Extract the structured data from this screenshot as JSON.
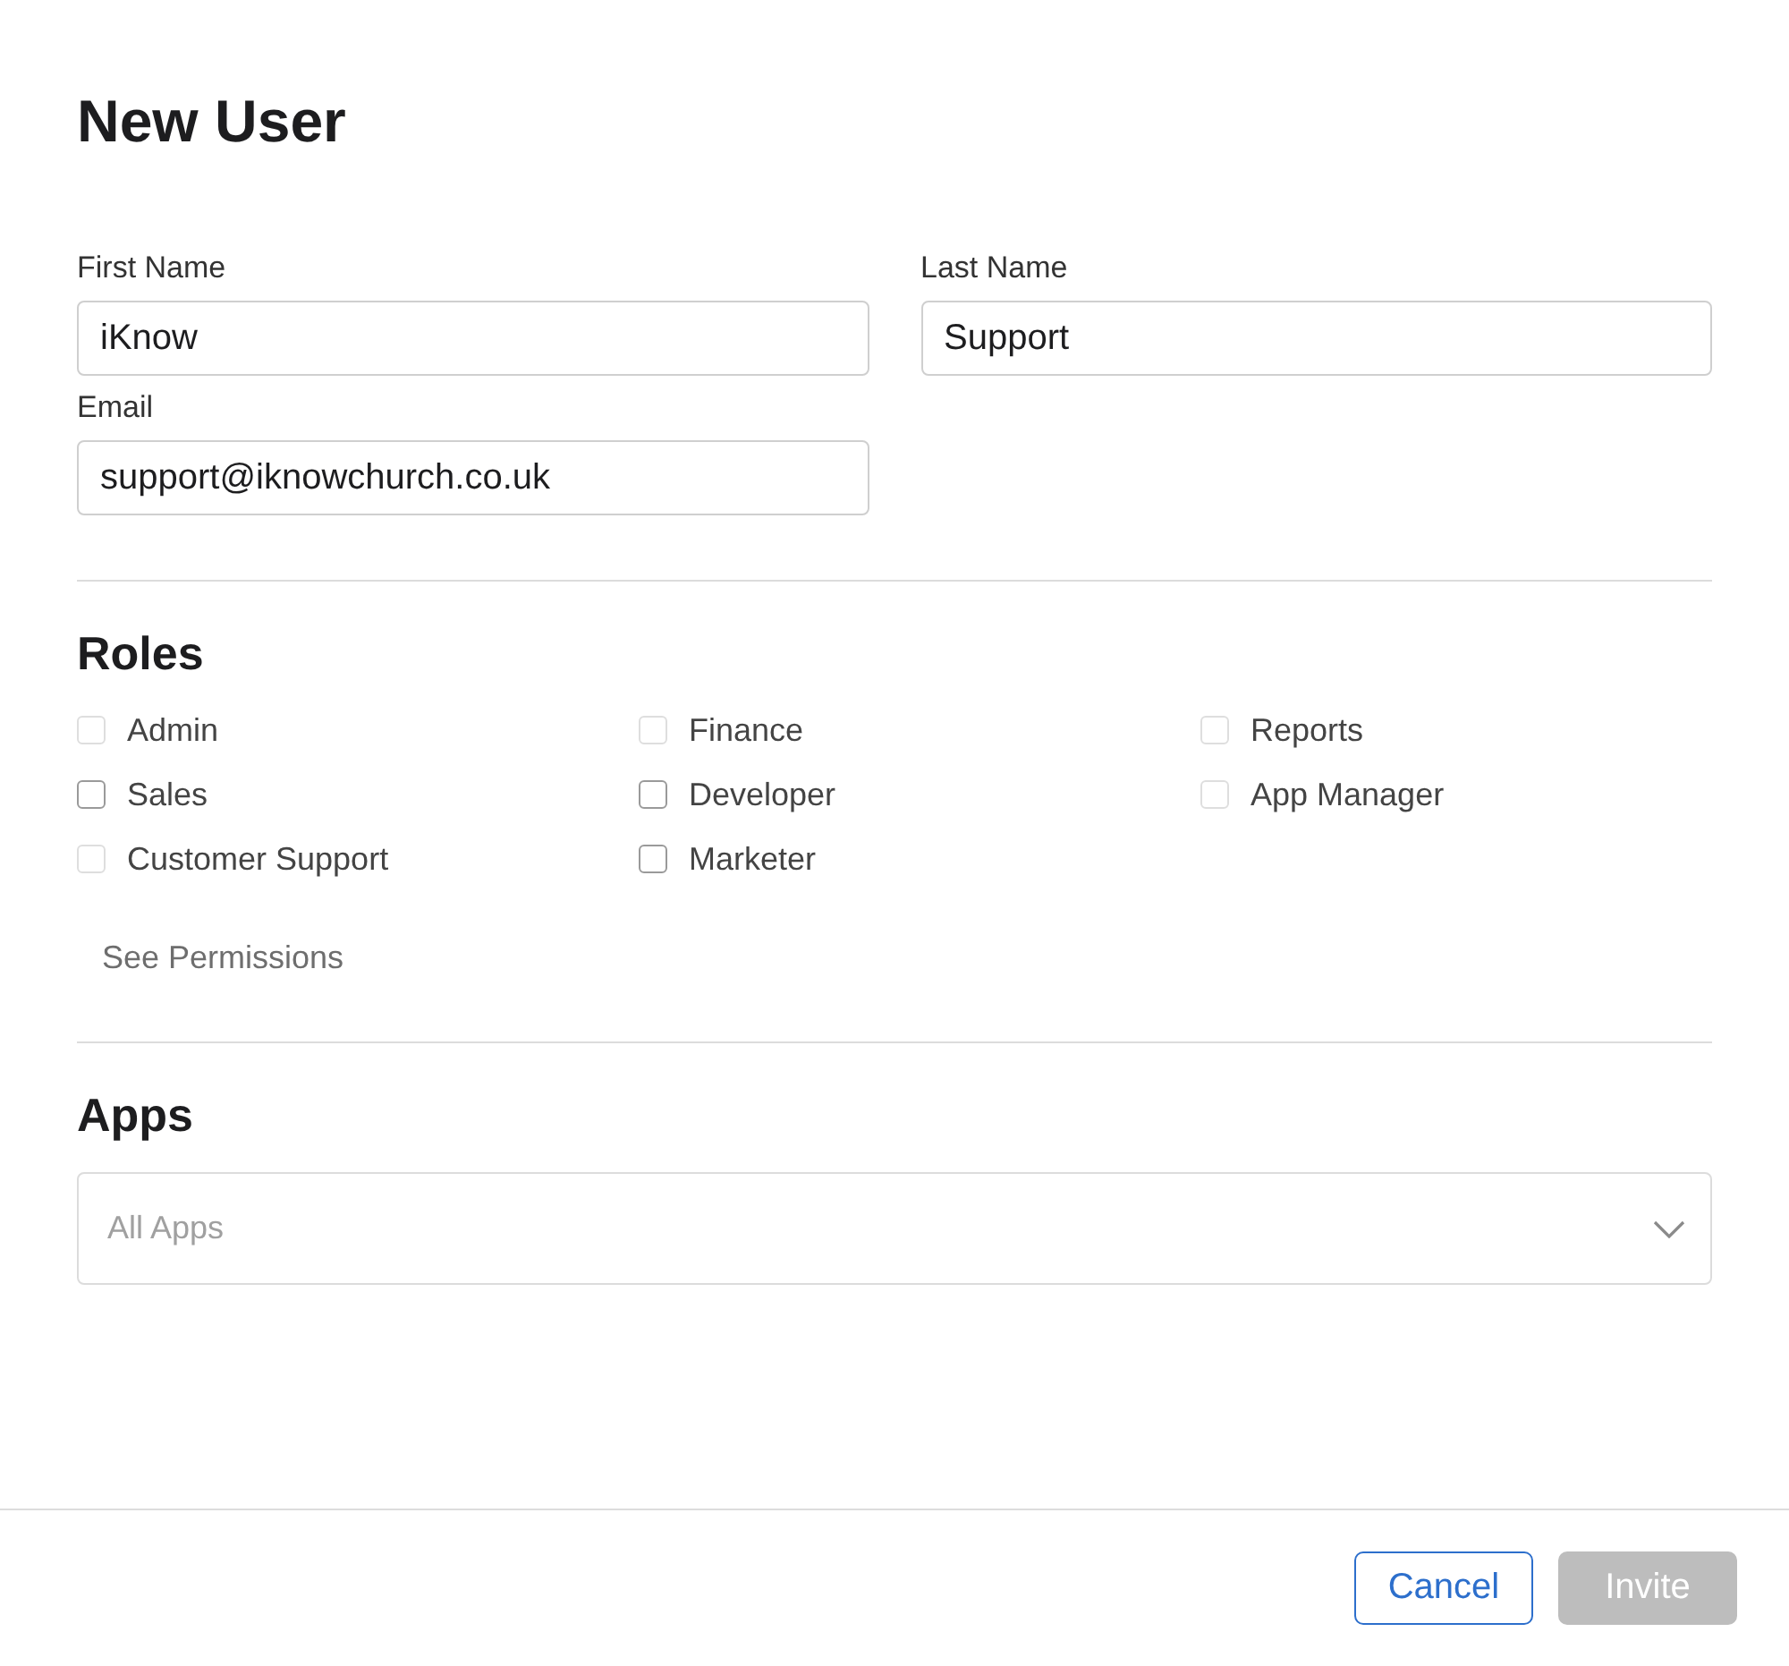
{
  "title": "New User",
  "fields": [
    {
      "label": "First Name",
      "value": "iKnow"
    },
    {
      "label": "Last Name",
      "value": "Support"
    },
    {
      "label": "Email",
      "value": "support@iknowchurch.co.uk"
    }
  ],
  "roles": {
    "heading": "Roles",
    "items": [
      {
        "label": "Admin",
        "checked": false,
        "disabled": true
      },
      {
        "label": "Finance",
        "checked": false,
        "disabled": true
      },
      {
        "label": "Reports",
        "checked": false,
        "disabled": true
      },
      {
        "label": "Sales",
        "checked": false,
        "disabled": false
      },
      {
        "label": "Developer",
        "checked": false,
        "disabled": false
      },
      {
        "label": "App Manager",
        "checked": false,
        "disabled": true
      },
      {
        "label": "Customer Support",
        "checked": false,
        "disabled": true
      },
      {
        "label": "Marketer",
        "checked": false,
        "disabled": false
      }
    ],
    "link": "See Permissions"
  },
  "apps": {
    "heading": "Apps",
    "placeholder": "All Apps"
  },
  "buttons": [
    {
      "label": "Cancel",
      "kind": "secondary",
      "disabled": false
    },
    {
      "label": "Invite",
      "kind": "primary",
      "disabled": true
    }
  ]
}
